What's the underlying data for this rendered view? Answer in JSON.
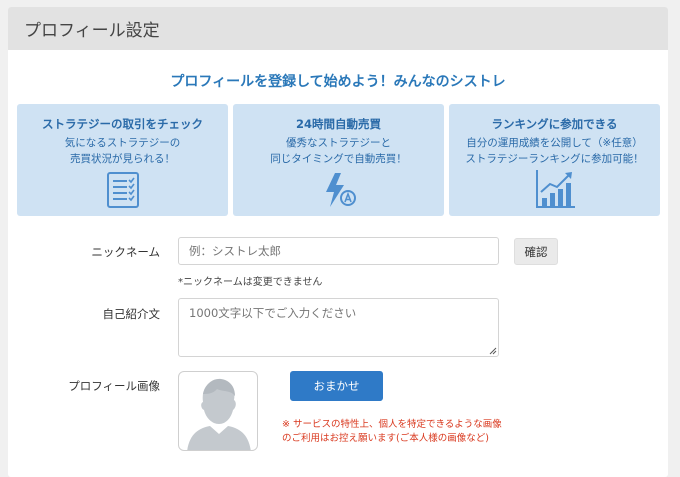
{
  "header": {
    "title": "プロフィール設定"
  },
  "headline": "プロフィールを登録して始めよう！みんなのシストレ",
  "features": [
    {
      "title": "ストラテジーの取引をチェック",
      "line1": "気になるストラテジーの",
      "line2": "売買状況が見られる！",
      "icon": "checklist-icon"
    },
    {
      "title": "24時間自動売買",
      "line1": "優秀なストラテジーと",
      "line2": "同じタイミングで自動売買！",
      "icon": "lightning-auto-icon"
    },
    {
      "title": "ランキングに参加できる",
      "line1": "自分の運用成績を公開して（※任意）",
      "line2": "ストラテジーランキングに参加可能！",
      "icon": "rising-chart-icon"
    }
  ],
  "form": {
    "nickname_label": "ニックネーム",
    "nickname_placeholder": "例：シストレ太郎",
    "confirm_button": "確認",
    "nickname_note": "*ニックネームは変更できません",
    "intro_label": "自己紹介文",
    "intro_placeholder": "1000文字以下でご入力ください",
    "image_label": "プロフィール画像",
    "auto_button": "おまかせ",
    "image_warning_1": "※ サービスの特性上、個人を特定できるような画像",
    "image_warning_2": "のご利用はお控え願います(ご本人様の画像など)"
  },
  "colors": {
    "accent": "#2f7ac7",
    "card_bg": "#cfe2f3",
    "warning": "#d9381e",
    "header_bg": "#e2e2e2"
  }
}
